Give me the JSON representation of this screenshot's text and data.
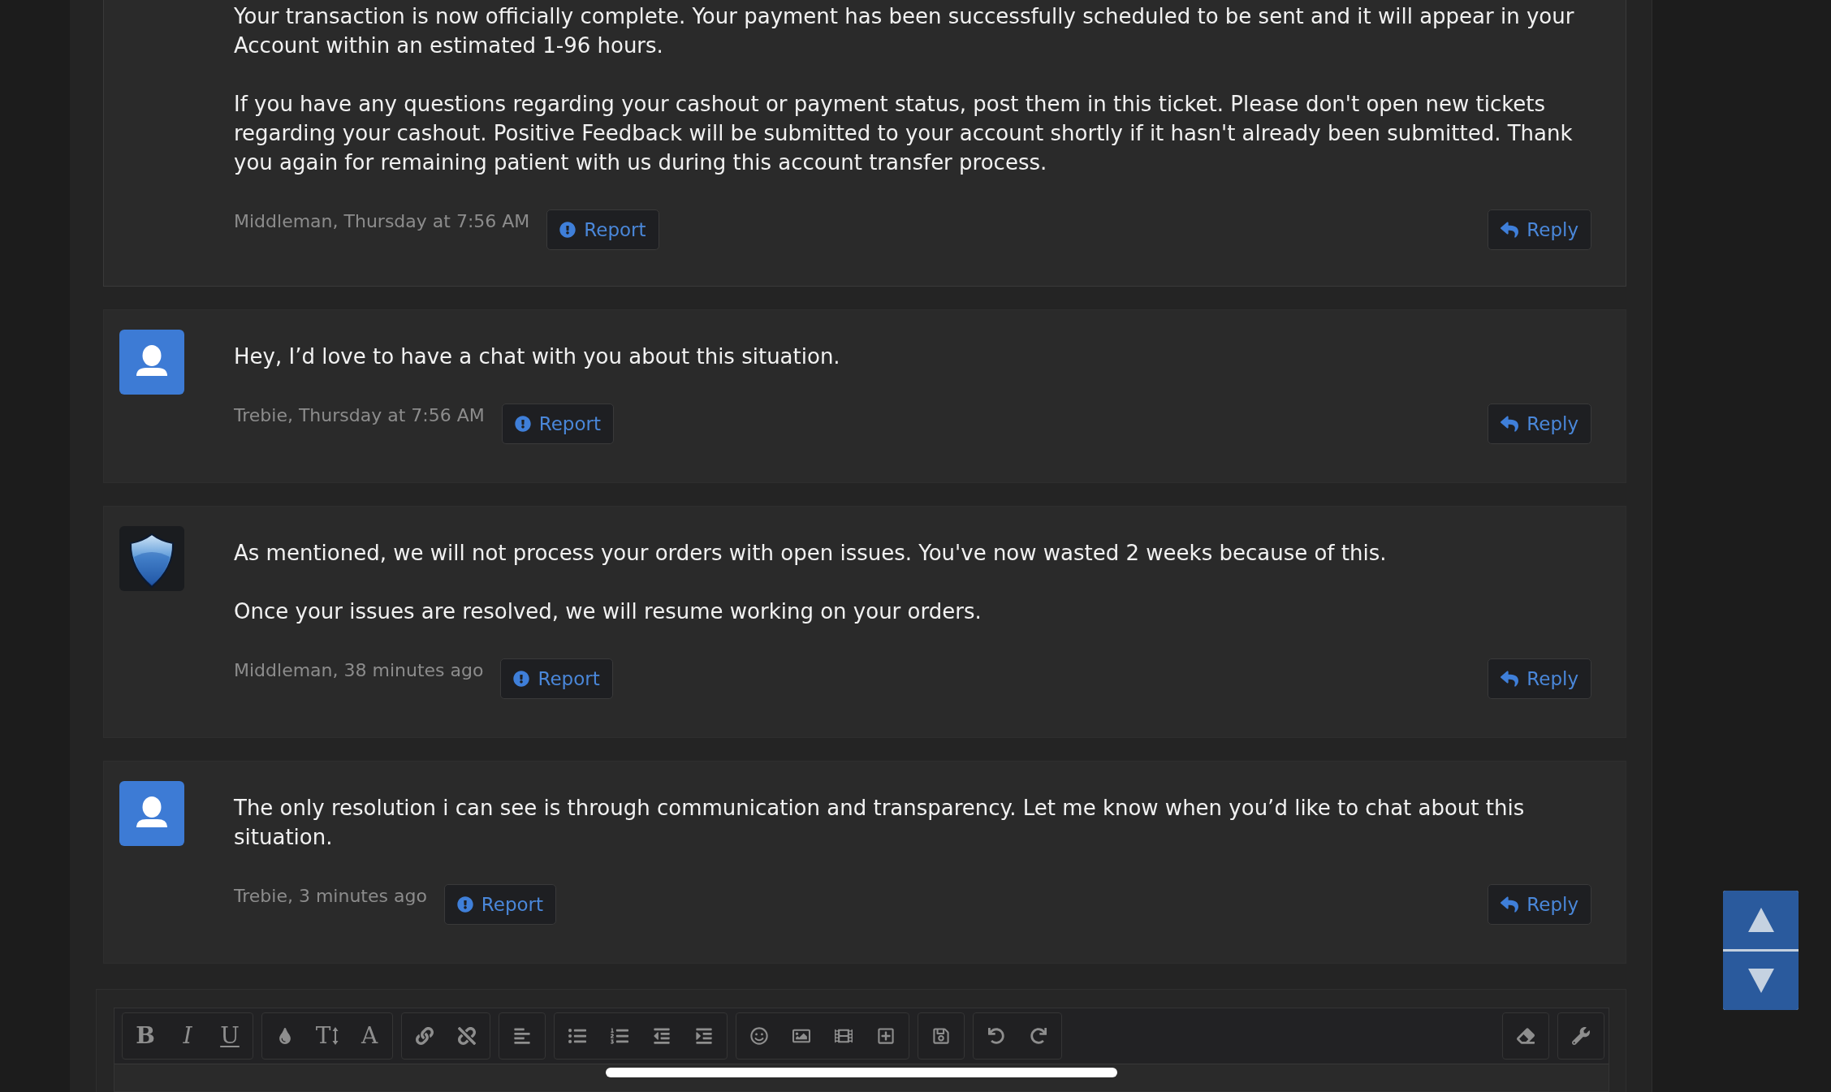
{
  "posts": [
    {
      "paragraphs": [
        "Your transaction is now officially complete. Your payment has been successfully scheduled to be sent and it will appear in your Account within an estimated 1-96 hours.",
        "If you have any questions regarding your cashout or payment status, post them in this ticket. Please don't open new tickets regarding your cashout. Positive Feedback will be submitted to your account shortly if it hasn't already been submitted. Thank you again for remaining patient with us during this account transfer process."
      ],
      "meta": "Middleman, Thursday at 7:56 AM",
      "report": "Report",
      "reply": "Reply"
    },
    {
      "avatar": {
        "kind": "silhouette"
      },
      "paragraphs": [
        "Hey, I’d love to have a chat with you about this situation."
      ],
      "meta": "Trebie, Thursday at 7:56 AM",
      "report": "Report",
      "reply": "Reply"
    },
    {
      "avatar": {
        "kind": "shield"
      },
      "paragraphs": [
        "As mentioned, we will not process your orders with open issues. You've now wasted 2 weeks because of this.",
        "Once your issues are resolved, we will resume working on your orders."
      ],
      "meta": "Middleman, 38 minutes ago",
      "report": "Report",
      "reply": "Reply"
    },
    {
      "avatar": {
        "kind": "silhouette"
      },
      "paragraphs": [
        "The only resolution i can see is through communication and transparency. Let me know when you’d like to chat about this situation."
      ],
      "meta": "Trebie, 3 minutes ago",
      "report": "Report",
      "reply": "Reply"
    }
  ],
  "editor": {
    "toolbar": {
      "style_buttons": [
        "B",
        "I",
        "U"
      ],
      "size_button": "T",
      "font_button": "A"
    }
  }
}
